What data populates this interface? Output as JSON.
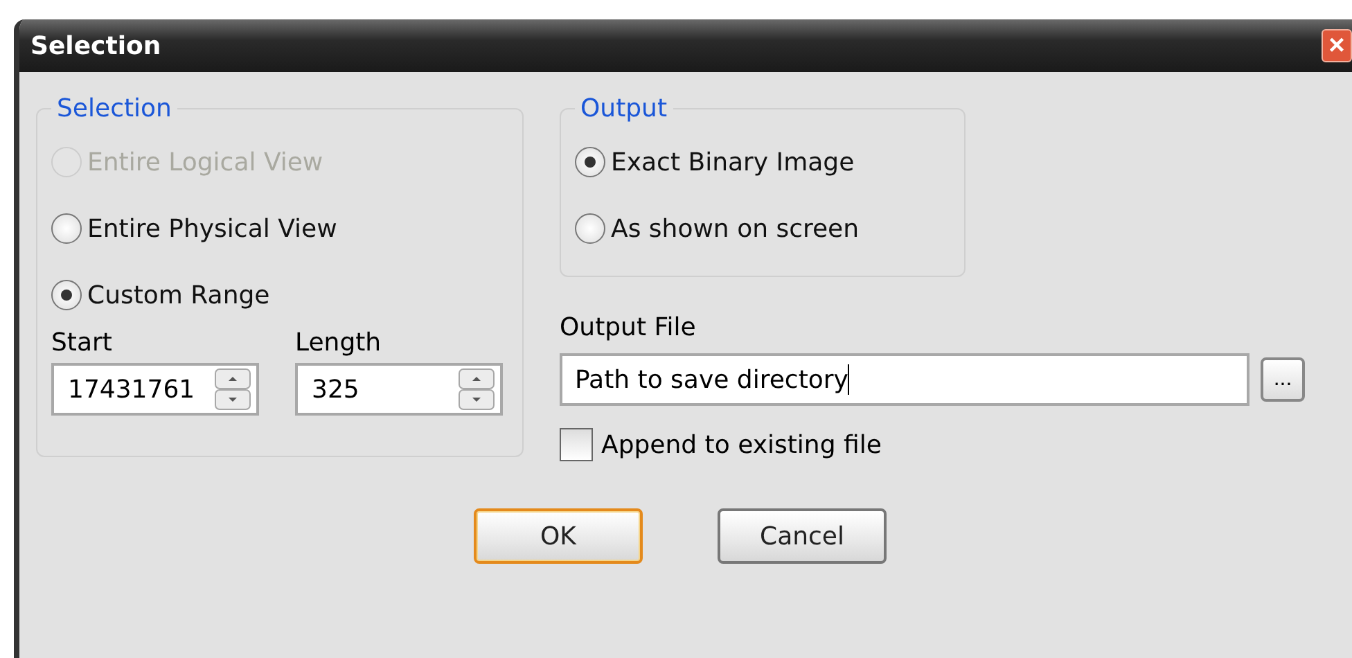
{
  "window": {
    "title": "Selection",
    "close": "×"
  },
  "selection_group": {
    "title": "Selection",
    "options": [
      {
        "label": "Entire Logical View",
        "selected": false,
        "disabled": true
      },
      {
        "label": "Entire Physical View",
        "selected": false,
        "disabled": false
      },
      {
        "label": "Custom Range",
        "selected": true,
        "disabled": false
      }
    ]
  },
  "start": {
    "label": "Start",
    "value": "17431761"
  },
  "length": {
    "label": "Length",
    "value": "325"
  },
  "output_group": {
    "title": "Output",
    "options": [
      {
        "label": "Exact Binary Image",
        "selected": true,
        "disabled": false
      },
      {
        "label": "As shown on screen",
        "selected": false,
        "disabled": false
      }
    ]
  },
  "output_file": {
    "label": "Output File",
    "value": "Path to save directory",
    "browse": "..."
  },
  "append": {
    "label": "Append to existing file",
    "checked": false
  },
  "buttons": [
    {
      "label": "OK",
      "default": true
    },
    {
      "label": "Cancel",
      "default": false
    }
  ]
}
